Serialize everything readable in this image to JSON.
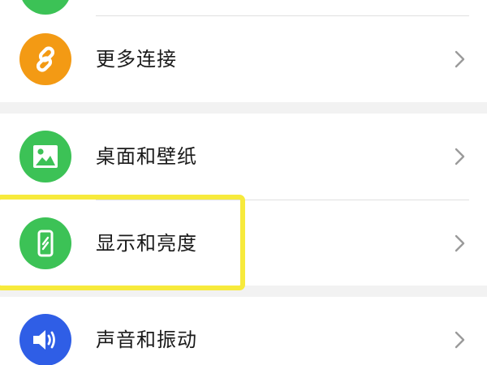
{
  "colors": {
    "more_connections_icon_bg": "#f39a14",
    "desktop_icon_bg": "#3cc256",
    "display_icon_bg": "#3cc256",
    "sound_icon_bg": "#2f5ee6",
    "highlight": "#f7ea3c",
    "chevron": "#9a9a9a",
    "partial_icon_bg": "#3cc256"
  },
  "settings": {
    "items": [
      {
        "label": "更多连接",
        "icon": "link-icon"
      },
      {
        "label": "桌面和壁纸",
        "icon": "image-icon"
      },
      {
        "label": "显示和亮度",
        "icon": "phone-display-icon"
      },
      {
        "label": "声音和振动",
        "icon": "speaker-icon"
      }
    ]
  }
}
